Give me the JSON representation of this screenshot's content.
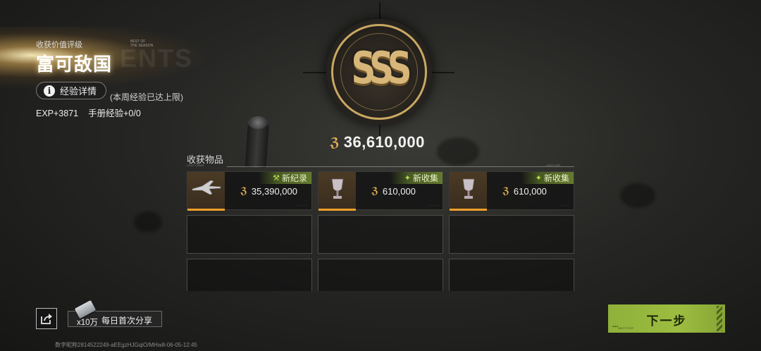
{
  "header": {
    "rating_label": "收获价值评级",
    "rating_value": "富可敌国",
    "exp_button_label": "经验详情",
    "exp_note": "(本周经验已达上限)",
    "exp_gain": "EXP+3871",
    "handbook_exp": "手册经验+0/0"
  },
  "badge": {
    "grade": "SSS",
    "total_value": "36,610,000"
  },
  "items": {
    "title": "收获物品",
    "cells": [
      {
        "icon": "fighter-jet-icon",
        "price": "35,390,000",
        "tag": "新纪录",
        "tag_icon": "hammer-icon"
      },
      {
        "icon": "trophy-icon",
        "price": "610,000",
        "tag": "新收集",
        "tag_icon": "sparkle-icon"
      },
      {
        "icon": "trophy-icon",
        "price": "610,000",
        "tag": "新收集",
        "tag_icon": "sparkle-icon"
      }
    ]
  },
  "bottom": {
    "reward_qty": "x10万",
    "reward_text": "每日首次分享",
    "next_button": "下一步",
    "footer_id": "数字昵称2814522249-aEEgzHJGqiO/MHw8-06-05-12:45"
  },
  "colors": {
    "accent_gold": "#d7b679",
    "accent_orange": "#f0a02a",
    "accent_green": "#9cbd40"
  }
}
